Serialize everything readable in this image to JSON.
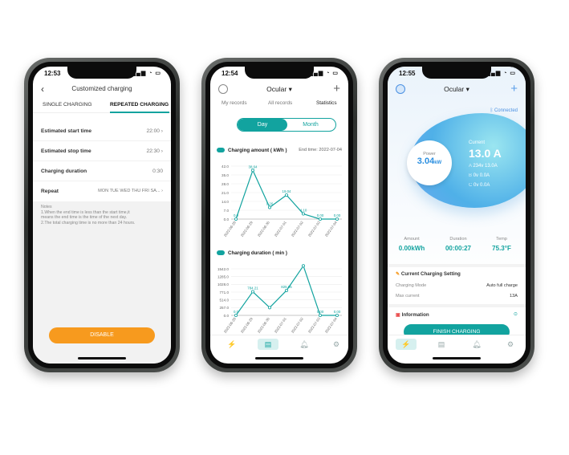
{
  "theme": {
    "accent": "#12a39f",
    "disable_button": "#f79a1e",
    "link": "#4a90e2"
  },
  "phone1": {
    "time": "12:53",
    "title": "Customized charging",
    "tabs": [
      "SINGLE CHARGING",
      "REPEATED CHARGING"
    ],
    "rows": [
      {
        "label": "Estimated start time",
        "value": "22:00"
      },
      {
        "label": "Estimated stop time",
        "value": "22:30"
      },
      {
        "label": "Charging duration",
        "value": "0:30"
      },
      {
        "label": "Repeat",
        "value": "MON TUE WED THU FRI SA..."
      }
    ],
    "notes_title": "Notes",
    "notes_line1": "1.When the end time is less than the start time,it",
    "notes_line2": "means the end time is the time of the next day.",
    "notes_line3": "2.The total charging time is no more than 24 hours.",
    "disable_label": "DISABLE"
  },
  "phone2": {
    "time": "12:54",
    "title": "Ocular",
    "tabs": [
      "My records",
      "All records",
      "Statistics"
    ],
    "segment": [
      "Day",
      "Month"
    ],
    "end_time": "End time: 2022-07-04",
    "chart_data": [
      {
        "type": "line",
        "title": "Charging amount ( kWh )",
        "x": [
          "2022-06-28",
          "2022-06-29",
          "2022-06-30",
          "2022-07-01",
          "2022-07-02",
          "2022-07-03",
          "2022-07-04"
        ],
        "values": [
          0.0,
          38.64,
          9.26,
          19.04,
          4.1,
          0.0,
          0.0
        ],
        "value_labels": [
          "0.0",
          "38.64",
          "9.26",
          "19.04",
          "4.10",
          "0.00",
          "0.00"
        ],
        "y_ticks": [
          "0.0",
          "7.0",
          "14.0",
          "21.0",
          "28.0",
          "35.0",
          "42.0"
        ],
        "ylim": [
          0,
          42
        ]
      },
      {
        "type": "line",
        "title": "Charging duration ( min )",
        "x": [
          "2022-06-28",
          "2022-06-29",
          "2022-06-30",
          "2022-07-01",
          "2022-07-02",
          "2022-07-03",
          "2022-07-04"
        ],
        "values": [
          0.0,
          784.21,
          257,
          825.05,
          1640.06,
          0.0,
          0.0
        ],
        "value_labels": [
          "0.0",
          "784.21",
          "",
          "825.05",
          "1640.06",
          "0.00",
          "0.00"
        ],
        "y_ticks": [
          "0.0",
          "257.0",
          "514.0",
          "771.0",
          "1028.0",
          "1285.0",
          "1542.0"
        ],
        "ylim": [
          0,
          1542
        ]
      }
    ]
  },
  "phone3": {
    "time": "12:55",
    "title": "Ocular",
    "connected": "Connected",
    "power_label": "Power",
    "power_value": "3.04",
    "power_unit": "kW",
    "current_label": "Current",
    "current_value": "13.0 A",
    "phases": [
      {
        "name": "A",
        "text": "234v 13.0A"
      },
      {
        "name": "B",
        "text": "0v 0.0A"
      },
      {
        "name": "C",
        "text": "0v 0.0A"
      }
    ],
    "metrics": [
      {
        "label": "Amount",
        "value": "0.00kWh"
      },
      {
        "label": "Duration",
        "value": "00:00:27"
      },
      {
        "label": "Temp",
        "value": "75.3°F"
      }
    ],
    "setting_title": "Current Charging Setting",
    "charging_mode_label": "Charging Mode",
    "charging_mode_value": "Auto full charge",
    "max_current_label": "Max current",
    "max_current_value": "13A",
    "information_label": "Information",
    "finish_label": "FINISH CHARGING"
  }
}
